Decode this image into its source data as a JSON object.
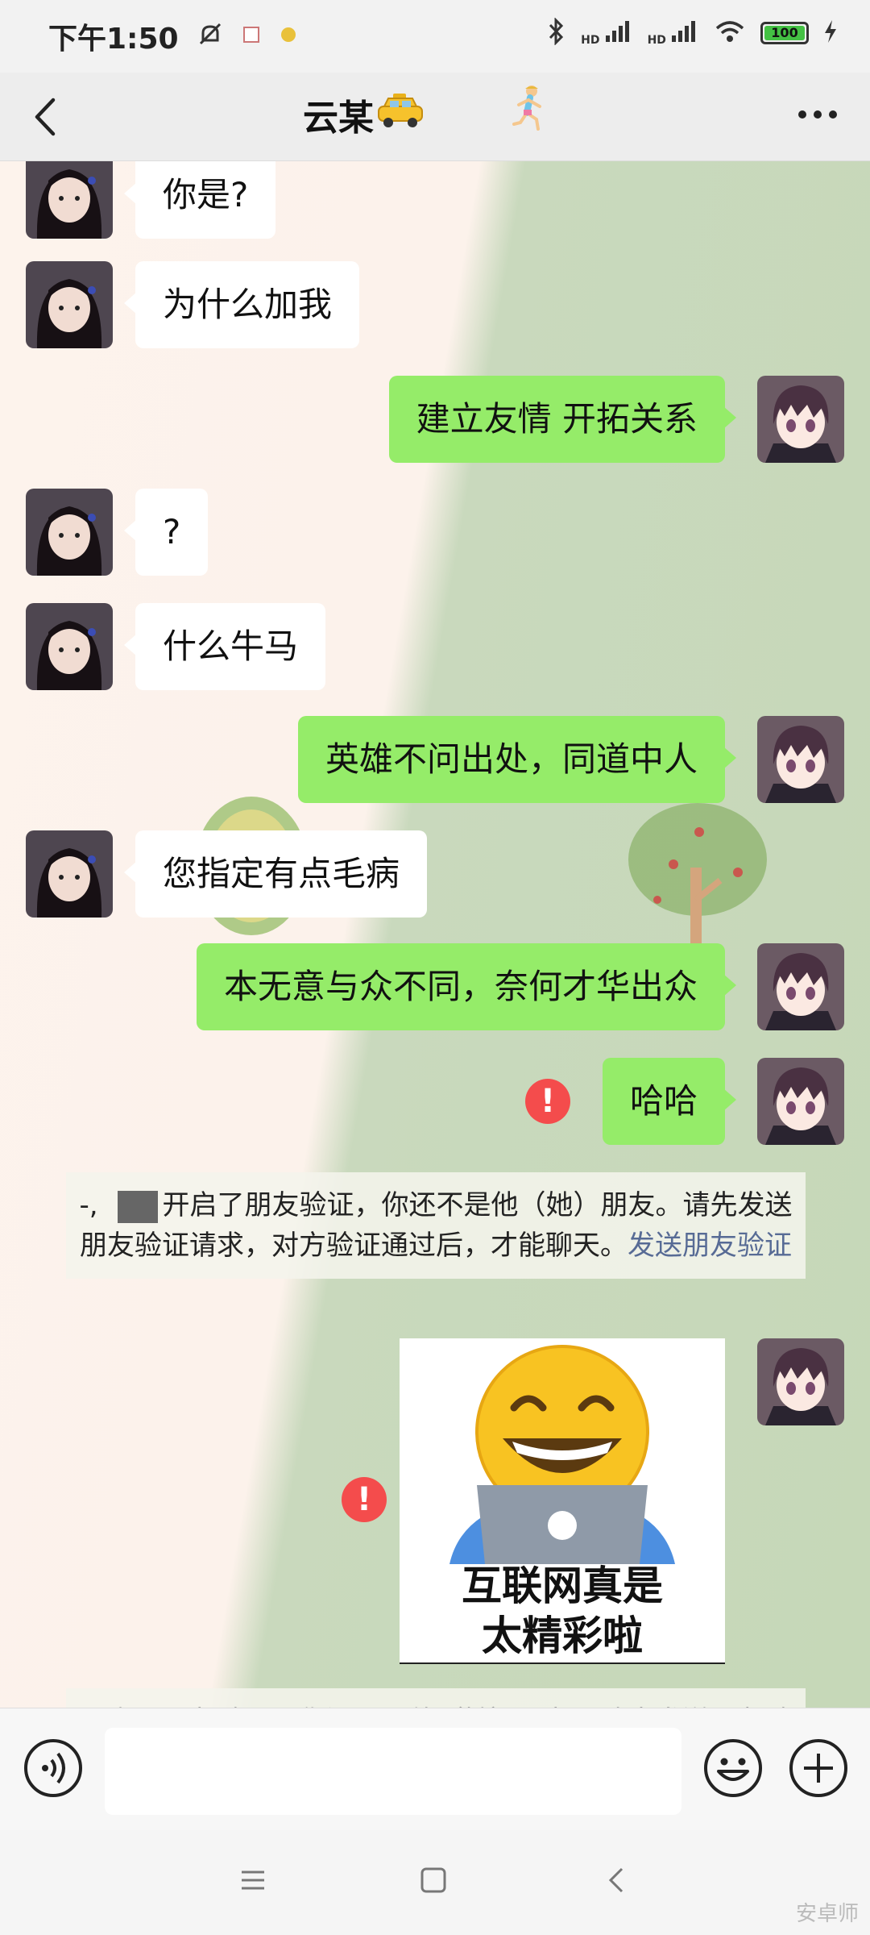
{
  "status_bar": {
    "time": "下午1:50",
    "battery": "100",
    "hd1": "HD",
    "hd2": "HD"
  },
  "header": {
    "title": "云某",
    "back_icon": "chevron-left-icon",
    "more_icon": "more-icon"
  },
  "messages": [
    {
      "side": "in",
      "text": "你是?"
    },
    {
      "side": "in",
      "text": "为什么加我"
    },
    {
      "side": "out",
      "text": "建立友情 开拓关系"
    },
    {
      "side": "in",
      "text": "?"
    },
    {
      "side": "in",
      "text": "什么牛马"
    },
    {
      "side": "out",
      "text": "英雄不问出处，同道中人"
    },
    {
      "side": "in",
      "text": "您指定有点毛病"
    },
    {
      "side": "out",
      "text": "本无意与众不同，奈何才华出众"
    },
    {
      "side": "out",
      "text": "哈哈",
      "failed": true
    }
  ],
  "notice": {
    "prefix": "-,",
    "text": "开启了朋友验证，你还不是他（她）朋友。请先发送朋友验证请求，对方验证通过后，才能聊天。",
    "link": "发送朋友验证"
  },
  "sticker": {
    "caption_line1": "互联网真是",
    "caption_line2": "太精彩啦",
    "failed": true
  },
  "error_mark": "!",
  "watermark": "安卓师",
  "colors": {
    "out_bubble": "#95ec69",
    "in_bubble": "#ffffff",
    "link": "#576b95",
    "error": "#f44c4c"
  }
}
